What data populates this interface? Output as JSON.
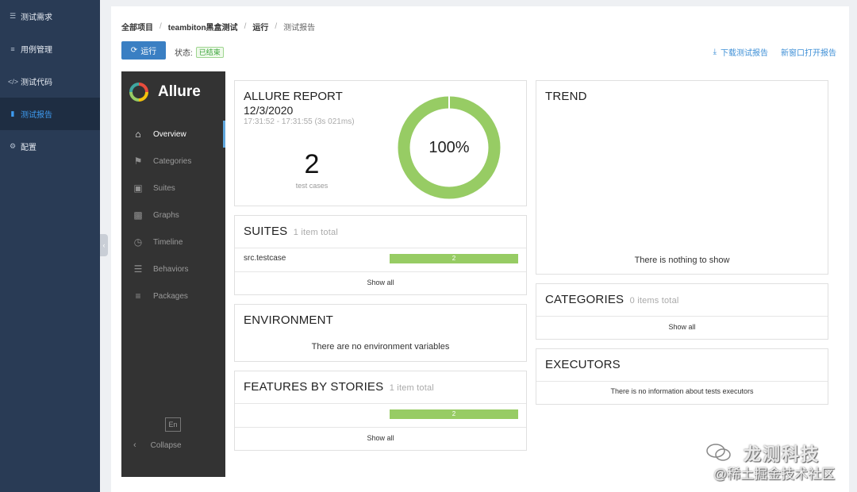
{
  "sidebar": {
    "items": [
      {
        "label": "测试需求",
        "icon": "sitemap-icon"
      },
      {
        "label": "用例管理",
        "icon": "list-icon"
      },
      {
        "label": "测试代码",
        "icon": "code-icon"
      },
      {
        "label": "测试报告",
        "icon": "file-icon",
        "active": true
      },
      {
        "label": "配置",
        "icon": "gear-icon"
      }
    ]
  },
  "breadcrumb": [
    "全部项目",
    "teambiton黑盒测试",
    "运行",
    "测试报告"
  ],
  "toolbar": {
    "run_label": "运行",
    "status_label": "状态:",
    "status_value": "已结束",
    "download_label": "下载测试报告",
    "open_window_label": "新窗口打开报告"
  },
  "allure": {
    "brand": "Allure",
    "nav": [
      {
        "label": "Overview",
        "icon": "home-icon",
        "active": true
      },
      {
        "label": "Categories",
        "icon": "flag-icon"
      },
      {
        "label": "Suites",
        "icon": "briefcase-icon"
      },
      {
        "label": "Graphs",
        "icon": "bar-chart-icon"
      },
      {
        "label": "Timeline",
        "icon": "clock-icon"
      },
      {
        "label": "Behaviors",
        "icon": "list-icon"
      },
      {
        "label": "Packages",
        "icon": "align-left-icon"
      }
    ],
    "language": "En",
    "collapse_label": "Collapse",
    "summary": {
      "title": "ALLURE REPORT",
      "date": "12/3/2020",
      "time_range": "17:31:52 - 17:31:55 (3s 021ms)",
      "count": "2",
      "count_label": "test cases",
      "pass_rate_label": "100%",
      "pass_rate": 1.0,
      "pass_color": "#97cc64"
    },
    "suites": {
      "title": "SUITES",
      "meta": "1 item total",
      "rows": [
        {
          "name": "src.testcase",
          "count": "2"
        }
      ],
      "show_all": "Show all"
    },
    "environment": {
      "title": "ENVIRONMENT",
      "empty_text": "There are no environment variables"
    },
    "features": {
      "title": "FEATURES BY STORIES",
      "meta": "1 item total",
      "rows": [
        {
          "name": "",
          "count": "2"
        }
      ],
      "show_all": "Show all"
    },
    "trend": {
      "title": "TREND",
      "empty_text": "There is nothing to show"
    },
    "categories": {
      "title": "CATEGORIES",
      "meta": "0 items total",
      "show_all": "Show all"
    },
    "executors": {
      "title": "EXECUTORS",
      "empty_text": "There is no information about tests executors"
    }
  },
  "watermark": {
    "line1": "龙测科技",
    "line2": "@稀土掘金技术社区"
  }
}
